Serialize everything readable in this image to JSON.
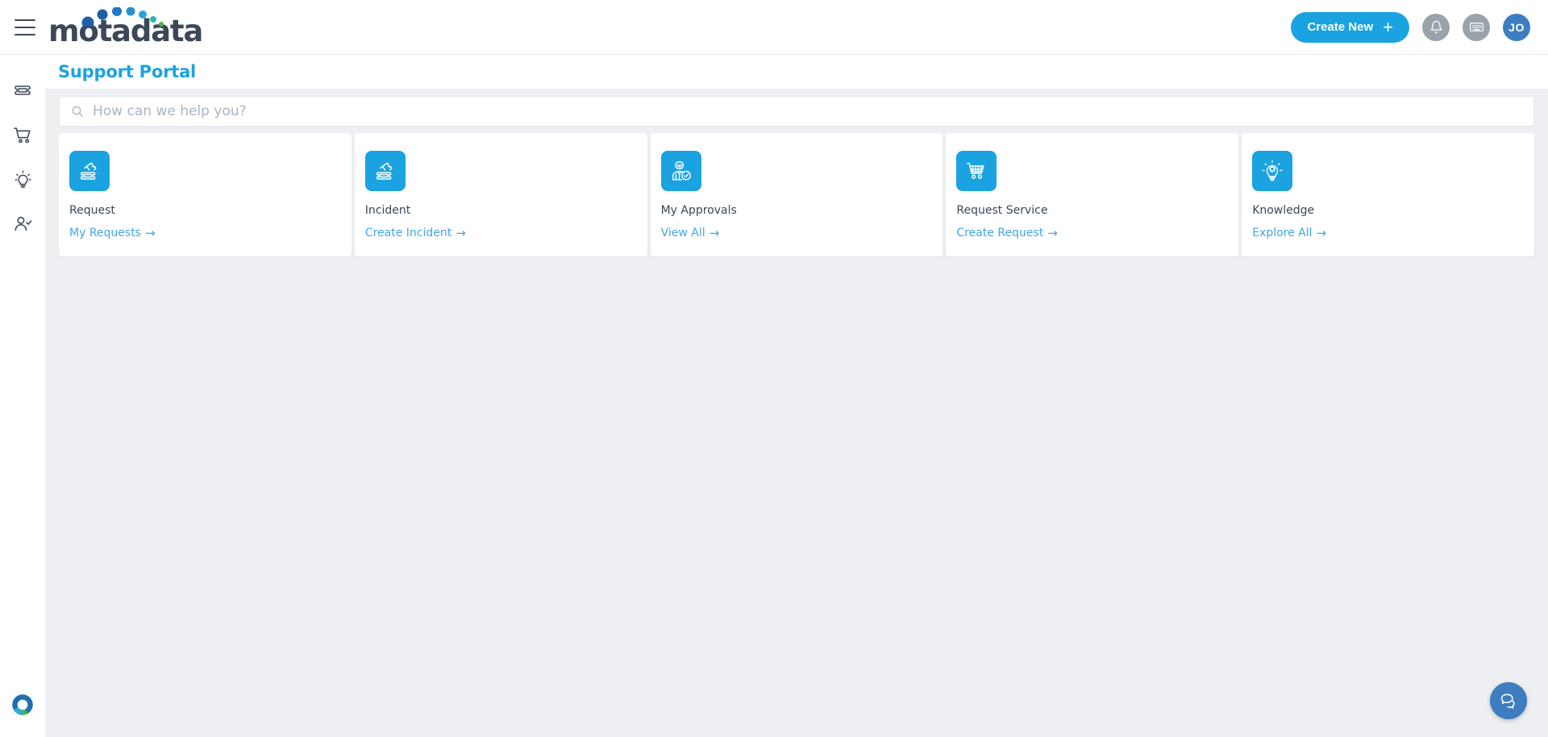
{
  "brand": {
    "name": "motadata"
  },
  "topbar": {
    "menu_label": "menu",
    "create_new_label": "Create New",
    "create_new_plus": "+",
    "avatar_initials": "JO"
  },
  "sidebar": {
    "items": [
      {
        "name": "tickets",
        "icon": "ticket-icon"
      },
      {
        "name": "service-catalog",
        "icon": "shopping-cart-icon"
      },
      {
        "name": "knowledge",
        "icon": "lightbulb-icon"
      },
      {
        "name": "approvals",
        "icon": "user-check-icon"
      }
    ]
  },
  "page": {
    "title": "Support Portal"
  },
  "search": {
    "placeholder": "How can we help you?",
    "value": ""
  },
  "cards": [
    {
      "title": "Request",
      "link": "My Requests",
      "arrow": "→",
      "icon": "ticket-stack-icon"
    },
    {
      "title": "Incident",
      "link": "Create Incident",
      "arrow": "→",
      "icon": "ticket-stack-icon"
    },
    {
      "title": "My Approvals",
      "link": "View All",
      "arrow": "→",
      "icon": "user-approval-icon"
    },
    {
      "title": "Request Service",
      "link": "Create Request",
      "arrow": "→",
      "icon": "shopping-cart-icon"
    },
    {
      "title": "Knowledge",
      "link": "Explore All",
      "arrow": "→",
      "icon": "lightbulb-gear-icon"
    }
  ],
  "chat": {
    "label": "chat"
  },
  "colors": {
    "accent": "#1aa3e0",
    "link": "#41a7e6",
    "avatar": "#3d7dc0",
    "page_bg": "#edeff2",
    "text": "#3c4858"
  }
}
